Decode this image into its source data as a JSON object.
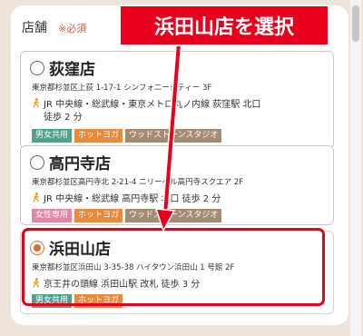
{
  "section": {
    "title": "店舗",
    "required": "※必須"
  },
  "stores": [
    {
      "name": "荻窪店",
      "address": "東京都杉並区上荻 1-17-1 シンフォニーシティー 3F",
      "access": "JR 中央線・総武線・東京メトロ丸ノ内線 荻窪駅 北口",
      "access_cont": "徒歩 2 分",
      "tags": [
        "男女共用",
        "ホットヨガ",
        "ウッドストーンスタジオ"
      ],
      "selected": false
    },
    {
      "name": "高円寺店",
      "address": "東京都杉並区高円寺北 2-21-4 ニリーベル高円寺スクエア 2F",
      "access": "JR 中央線・総武線 高円寺駅 北口 徒歩 2 分",
      "access_cont": "",
      "tags": [
        "女性専用",
        "ホットヨガ",
        "ウッドストーンスタジオ"
      ],
      "selected": false
    },
    {
      "name": "浜田山店",
      "address": "東京都杉並区浜田山 3-35-38 ハイタウン浜田山 1 号館 2F",
      "access": "京王井の頭線 浜田山駅 改札 徒歩 3 分",
      "access_cont": "",
      "tags": [
        "男女共用",
        "ホットヨガ"
      ],
      "selected": true
    }
  ],
  "annotation": {
    "callout": "浜田山店を選択"
  },
  "colors": {
    "accent": "#e46a2c",
    "annotation_red": "#e8001c",
    "tag_green": "#4fa08d",
    "tag_pink": "#e286a2",
    "tag_orange": "#e68a3f",
    "tag_stone": "#a48b74"
  }
}
